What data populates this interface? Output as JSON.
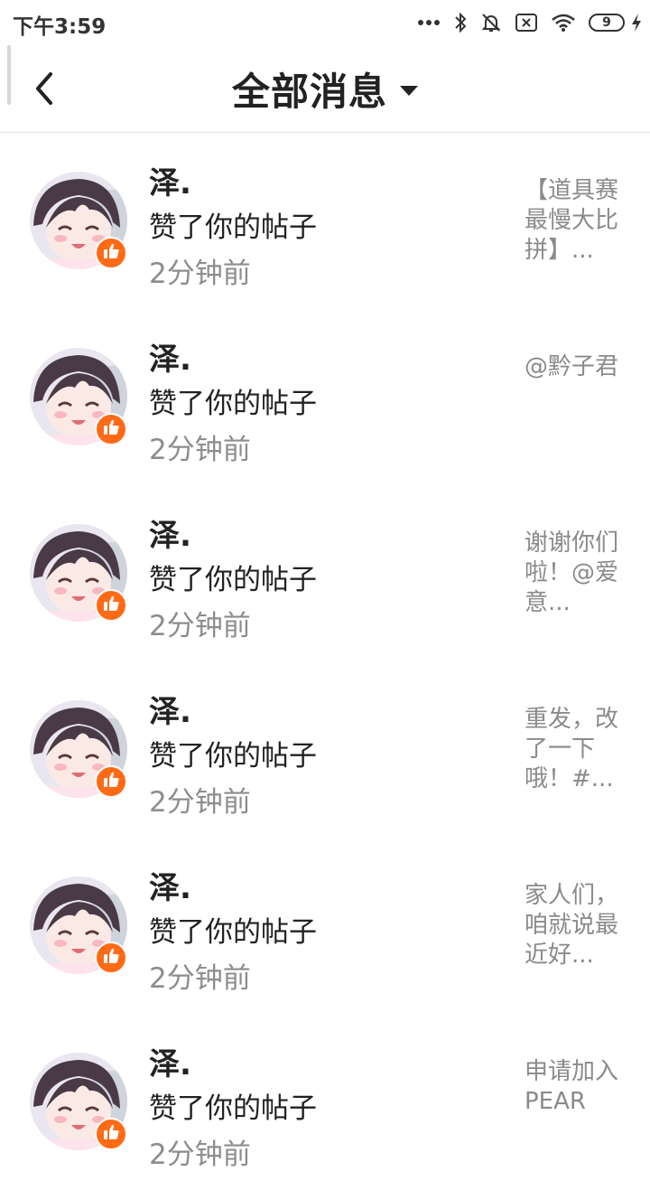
{
  "status_bar": {
    "time": "下午3:59",
    "battery": "9",
    "icons": [
      "more-dots-icon",
      "bluetooth-icon",
      "mute-bell-icon",
      "no-sim-icon",
      "wifi-icon",
      "battery-icon",
      "charging-icon"
    ]
  },
  "header": {
    "title": "全部消息",
    "back_icon": "chevron-left-icon",
    "dropdown_icon": "caret-down-icon"
  },
  "colors": {
    "like_badge": "#ff6a16",
    "time_text": "#8d8d8d",
    "preview_text": "#8a8a8a"
  },
  "messages": [
    {
      "user": "泽.",
      "action": "赞了你的帖子",
      "time": "2分钟前",
      "preview": "【道具赛最慢大比拼】..."
    },
    {
      "user": "泽.",
      "action": "赞了你的帖子",
      "time": "2分钟前",
      "preview": "@黔子君"
    },
    {
      "user": "泽.",
      "action": "赞了你的帖子",
      "time": "2分钟前",
      "preview": "谢谢你们啦！@爱意..."
    },
    {
      "user": "泽.",
      "action": "赞了你的帖子",
      "time": "2分钟前",
      "preview": "重发，改了一下哦！#..."
    },
    {
      "user": "泽.",
      "action": "赞了你的帖子",
      "time": "2分钟前",
      "preview": "家人们，咱就说最近好..."
    },
    {
      "user": "泽.",
      "action": "赞了你的帖子",
      "time": "2分钟前",
      "preview": "申请加入PEAR"
    }
  ]
}
